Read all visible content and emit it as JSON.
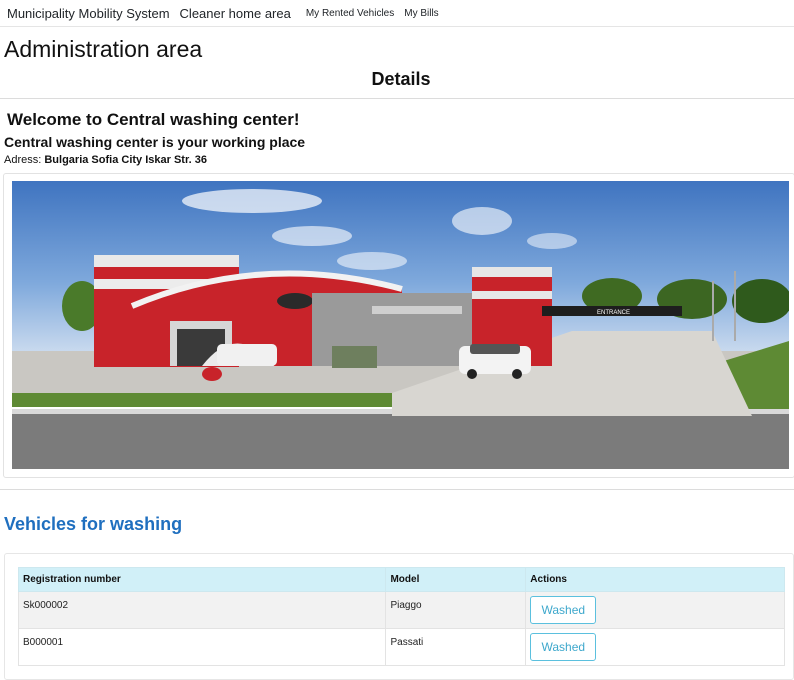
{
  "navbar": {
    "brand": "Municipality Mobility System",
    "links": [
      "Cleaner home area",
      "My Rented Vehicles",
      "My Bills"
    ]
  },
  "page": {
    "title": "Administration area",
    "subtitle": "Details"
  },
  "center": {
    "welcome": "Welcome to Central washing center!",
    "working_place": "Central washing center is your working place",
    "address_label": "Adress:",
    "address_value": "Bulgaria Sofia City Iskar Str. 36",
    "photo_sign_entrance": "ENTRANCE"
  },
  "vehicles": {
    "section_title": "Vehicles for washing",
    "columns": [
      "Registration number",
      "Model",
      "Actions"
    ],
    "rows": [
      {
        "registration": "Sk000002",
        "model": "Piaggo",
        "action": "Washed"
      },
      {
        "registration": "B000001",
        "model": "Passati",
        "action": "Washed"
      }
    ]
  },
  "colors": {
    "link_blue": "#1f6fbf",
    "table_header_bg": "#d1f0f8",
    "button_border": "#5bc0de"
  }
}
